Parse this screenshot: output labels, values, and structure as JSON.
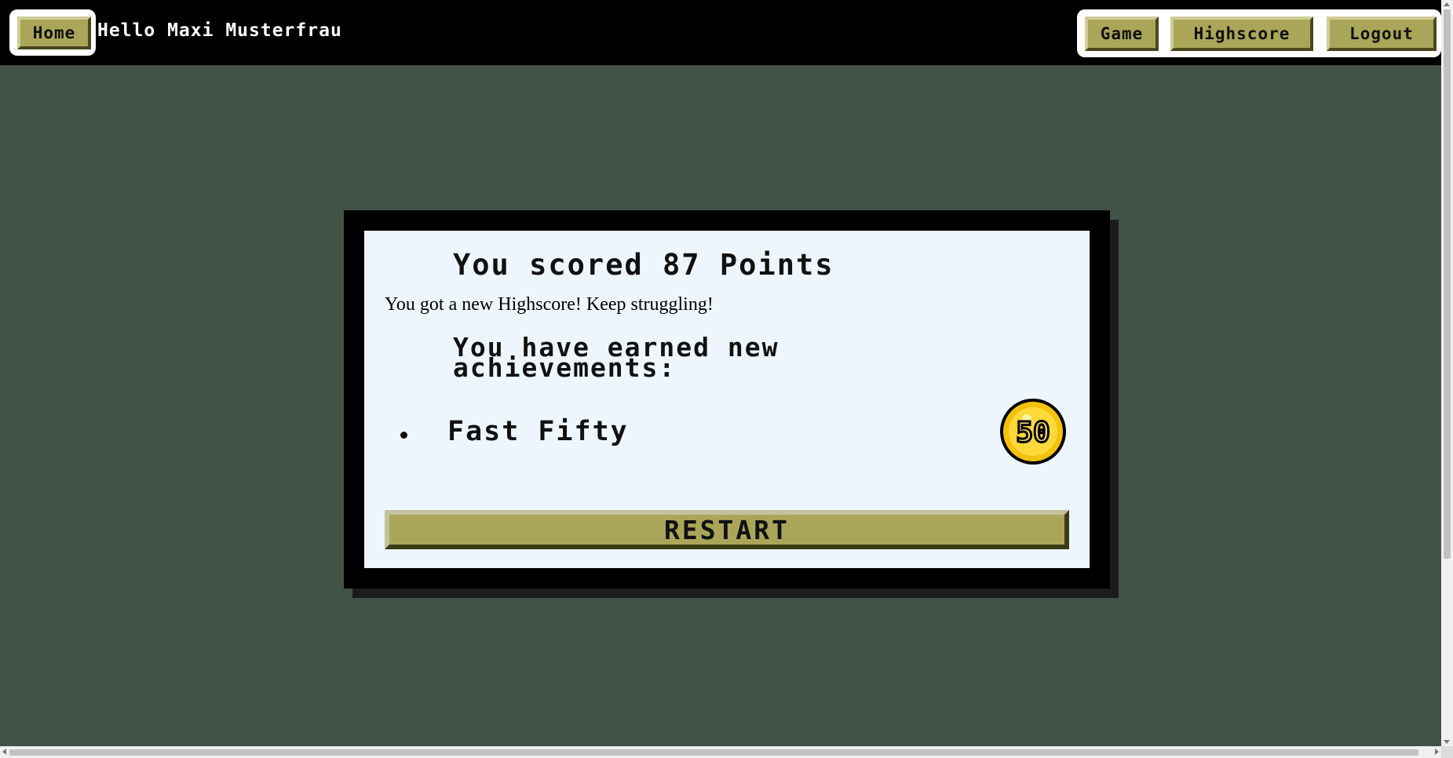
{
  "header": {
    "home_label": "Home",
    "greeting": "Hello Maxi Musterfrau",
    "nav": {
      "game_label": "Game",
      "highscore_label": "Highscore",
      "logout_label": "Logout"
    }
  },
  "result": {
    "score_title": "You scored 87 Points",
    "highscore_message": "You got a new Highscore! Keep struggling!",
    "achievements_title": "You have earned new achievements:",
    "achievements": [
      {
        "name": "Fast Fifty",
        "badge_text": "50",
        "icon": "gold-coin-50-icon"
      }
    ],
    "restart_label": "RESTART"
  },
  "colors": {
    "background": "#435246",
    "button": "#a9a659",
    "panel": "#eef6fd",
    "topbar": "#000000"
  }
}
